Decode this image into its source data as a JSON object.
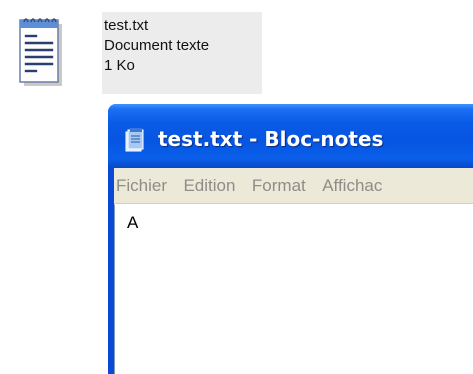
{
  "file": {
    "name": "test.txt",
    "type": "Document texte",
    "size": "1 Ko",
    "icon": "notepad-text-file-icon"
  },
  "window": {
    "title": "test.txt - Bloc-notes",
    "title_icon": "notepad-app-icon",
    "menu": [
      "Fichier",
      "Edition",
      "Format",
      "Affichac"
    ],
    "content": "A",
    "colors": {
      "titlebar": "#0a5ae6",
      "menubar": "#ece9d8",
      "menu_text_disabled": "#8e8d88"
    }
  }
}
